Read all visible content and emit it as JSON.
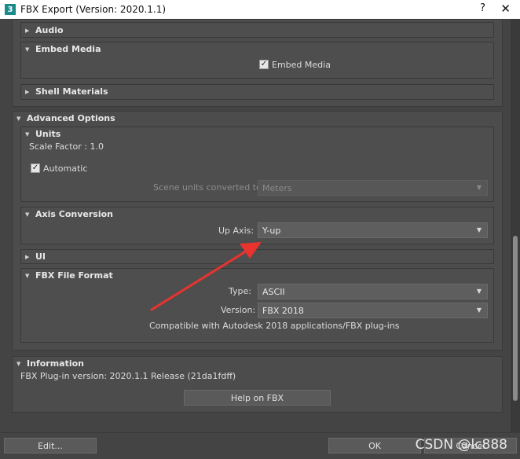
{
  "window": {
    "title": "FBX Export (Version: 2020.1.1)",
    "help": "?",
    "close": "✕",
    "icon_glyph": "3"
  },
  "sections": {
    "audio": {
      "title": "Audio"
    },
    "embed_media": {
      "title": "Embed Media",
      "checkbox_label": "Embed Media",
      "checked": true
    },
    "shell_materials": {
      "title": "Shell Materials"
    },
    "advanced": {
      "title": "Advanced Options",
      "units": {
        "title": "Units",
        "scale_factor": "Scale Factor : 1.0",
        "automatic_label": "Automatic",
        "automatic_checked": true,
        "scene_units_label": "Scene units converted to:",
        "scene_units_value": "Meters"
      },
      "axis": {
        "title": "Axis Conversion",
        "up_axis_label": "Up Axis:",
        "up_axis_value": "Y-up"
      },
      "ui": {
        "title": "UI"
      },
      "fbx_format": {
        "title": "FBX File Format",
        "type_label": "Type:",
        "type_value": "ASCII",
        "version_label": "Version:",
        "version_value": "FBX 2018",
        "compat_text": "Compatible with Autodesk 2018 applications/FBX plug-ins"
      }
    },
    "information": {
      "title": "Information",
      "plugin_version": "FBX Plug-in version: 2020.1.1 Release (21da1fdff)",
      "help_button": "Help on FBX"
    }
  },
  "footer": {
    "edit_button": "Edit...",
    "ok_button": "OK",
    "cancel_button": "Cancel"
  },
  "watermark": "CSDN @lc888",
  "colors": {
    "annotation_arrow": "#e8332f"
  }
}
